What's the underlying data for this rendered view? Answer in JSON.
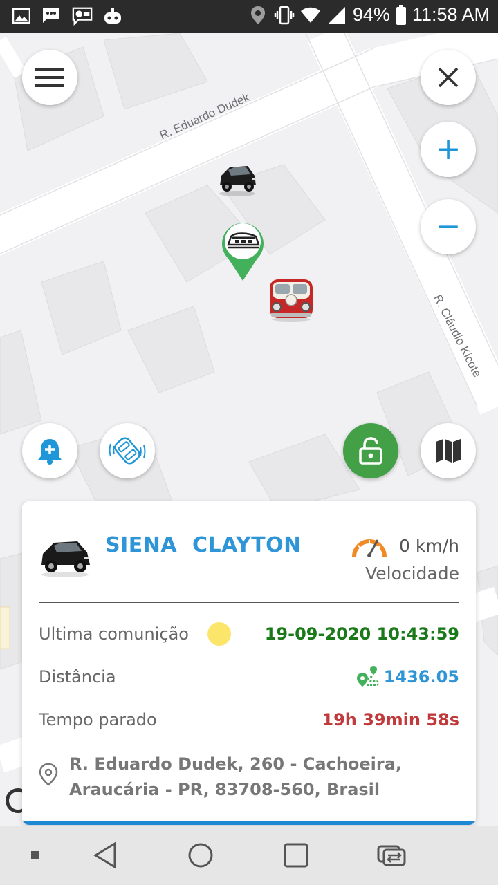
{
  "status_bar": {
    "battery_percent": "94%",
    "time": "11:58 AM",
    "icons": [
      "image-icon",
      "sms-icon",
      "lg-messages-icon",
      "android-icon",
      "location-icon",
      "vibrate-icon",
      "wifi-icon",
      "signal-icon",
      "battery-icon"
    ]
  },
  "map": {
    "streets": {
      "dudek": "R. Eduardo Dudek",
      "kicote": "R. Cláudio Kicote"
    },
    "buttons": {
      "zoom_in": "+",
      "zoom_out": "−"
    }
  },
  "card": {
    "vehicle_name": "SIENA  CLAYTON",
    "speed_value": "0 km/h",
    "speed_label": "Velocidade",
    "last_comm_label": "Ultima comunição",
    "last_comm_value": "19-09-2020 10:43:59",
    "distance_label": "Distância",
    "distance_value": "1436.05",
    "stopped_label": "Tempo parado",
    "stopped_value": "19h 39min 58s",
    "address": "R. Eduardo Dudek, 260 - Cachoeira, Araucária - PR, 83708-560, Brasil"
  },
  "colors": {
    "accent_blue": "#1e96d8",
    "lock_green": "#43a047",
    "comm_green": "#1a7a1a",
    "stopped_red": "#c0393b",
    "status_yellow": "#fbe56b"
  },
  "nav_bar": {
    "icons": [
      "square-dot-icon",
      "back-icon",
      "home-icon",
      "recents-icon",
      "switch-app-icon"
    ]
  }
}
